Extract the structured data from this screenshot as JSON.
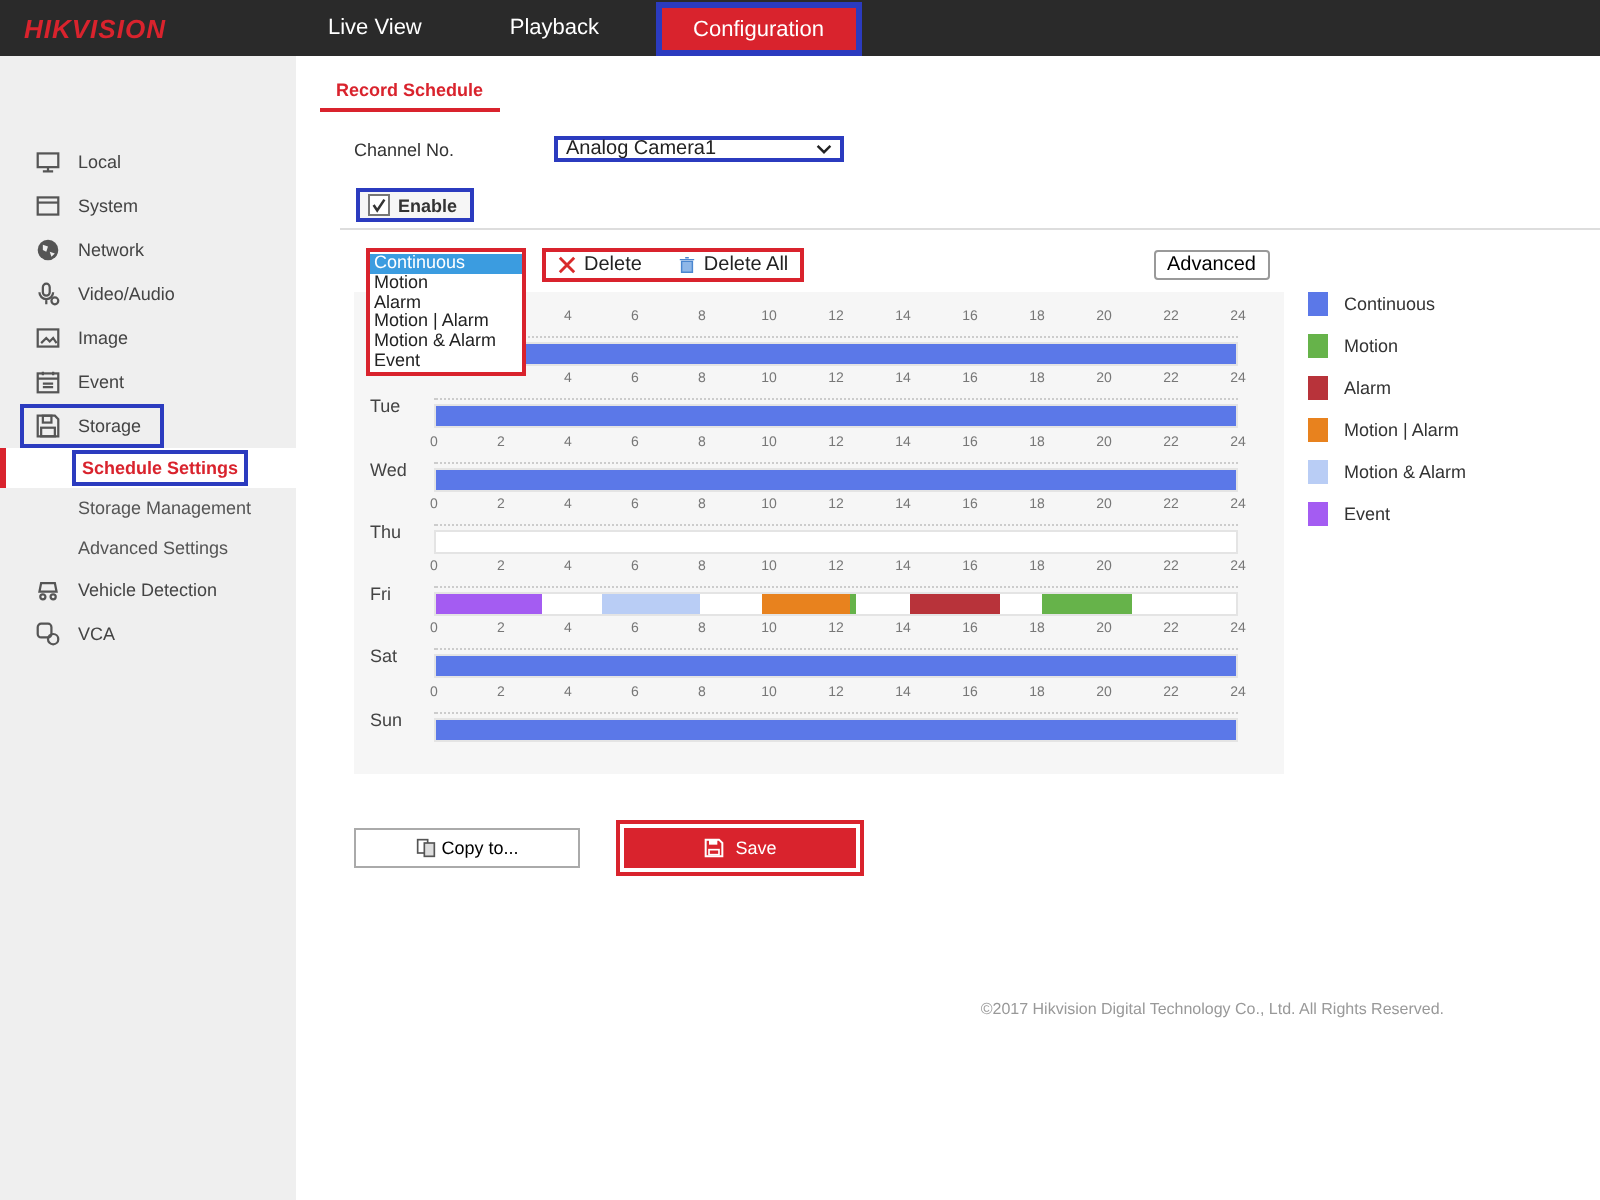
{
  "header": {
    "logo": "HIKVISION",
    "nav": [
      {
        "label": "Live View",
        "selected": false
      },
      {
        "label": "Playback",
        "selected": false
      },
      {
        "label": "Configuration",
        "selected": true,
        "color": "#2b3bbf"
      }
    ]
  },
  "sidebar": {
    "items": [
      {
        "label": "Local",
        "selected": false
      },
      {
        "label": "System",
        "selected": false
      },
      {
        "label": "Network",
        "selected": false
      },
      {
        "label": "Video/Audio",
        "selected": false
      },
      {
        "label": "Image",
        "selected": false
      },
      {
        "label": "Event",
        "selected": false
      },
      {
        "label": "Storage",
        "selected": false,
        "color": "#2b3bbf",
        "children": [
          {
            "label": "Schedule Settings",
            "selected": true,
            "color": "#2b3bbf"
          },
          {
            "label": "Storage Management",
            "selected": false
          },
          {
            "label": "Advanced Settings",
            "selected": false
          }
        ]
      },
      {
        "label": "Vehicle Detection",
        "selected": false
      },
      {
        "label": "VCA",
        "selected": false
      }
    ]
  },
  "tabs": [
    {
      "label": "Record Schedule",
      "selected": true
    }
  ],
  "channel": {
    "label": "Channel No.",
    "value": "Analog Camera1",
    "color": "#2b3bbf"
  },
  "enable": {
    "label": "Enable",
    "checked": true,
    "color": "#2b3bbf"
  },
  "record_type_list": {
    "color": "#d9232d",
    "options": [
      {
        "label": "Continuous",
        "selected": true
      },
      {
        "label": "Motion",
        "selected": false
      },
      {
        "label": "Alarm",
        "selected": false
      },
      {
        "label": "Motion | Alarm",
        "selected": false
      },
      {
        "label": "Motion & Alarm",
        "selected": false
      },
      {
        "label": "Event",
        "selected": false
      }
    ]
  },
  "toolbar": {
    "color": "#d9232d",
    "buttons": [
      {
        "kind": "delete",
        "label": "Delete"
      },
      {
        "kind": "delete_all",
        "label": "Delete All"
      }
    ],
    "advanced": "Advanced"
  },
  "schedule": {
    "days": [
      {
        "ticks": [
          "4",
          "6",
          "8",
          "10",
          "12",
          "14",
          "16",
          "18",
          "20",
          "22",
          "24"
        ],
        "segments": [
          {
            "kind": "continuous"
          }
        ]
      },
      {
        "day": "Tue",
        "ticks": [
          "4",
          "6",
          "8",
          "10",
          "12",
          "14",
          "16",
          "18",
          "20",
          "22",
          "24"
        ],
        "segments": [
          {
            "kind": "continuous"
          }
        ]
      },
      {
        "day": "Wed",
        "ticks": [
          "0",
          "2",
          "4",
          "6",
          "8",
          "10",
          "12",
          "14",
          "16",
          "18",
          "20",
          "22",
          "24"
        ],
        "segments": [
          {
            "kind": "continuous"
          }
        ]
      },
      {
        "day": "Thu",
        "ticks": [
          "0",
          "2",
          "4",
          "6",
          "8",
          "10",
          "12",
          "14",
          "16",
          "18",
          "20",
          "22",
          "24"
        ]
      },
      {
        "day": "Fri",
        "ticks": [
          "0",
          "2",
          "4",
          "6",
          "8",
          "10",
          "12",
          "14",
          "16",
          "18",
          "20",
          "22",
          "24"
        ],
        "segments": [
          {
            "kind": "event"
          },
          {
            "kind": "motion_and_alarm"
          },
          {
            "kind": "motion_or_alarm"
          },
          {
            "kind": "motion"
          },
          {
            "kind": "alarm"
          },
          {
            "kind": "motion"
          }
        ]
      },
      {
        "day": "Sat",
        "ticks": [
          "0",
          "2",
          "4",
          "6",
          "8",
          "10",
          "12",
          "14",
          "16",
          "18",
          "20",
          "22",
          "24"
        ],
        "segments": [
          {
            "kind": "continuous"
          }
        ]
      },
      {
        "day": "Sun",
        "ticks": [
          "0",
          "2",
          "4",
          "6",
          "8",
          "10",
          "12",
          "14",
          "16",
          "18",
          "20",
          "22",
          "24"
        ],
        "segments": [
          {
            "kind": "continuous"
          }
        ]
      }
    ]
  },
  "legend": [
    {
      "kind": "continuous",
      "label": "Continuous",
      "color": "#5b78e8"
    },
    {
      "kind": "motion",
      "label": "Motion",
      "color": "#66b34a"
    },
    {
      "kind": "alarm",
      "label": "Alarm",
      "color": "#b8333a"
    },
    {
      "kind": "motion_or_alarm",
      "label": "Motion | Alarm",
      "color": "#e8821e"
    },
    {
      "kind": "motion_and_alarm",
      "label": "Motion & Alarm",
      "color": "#b9cdf5"
    },
    {
      "kind": "event",
      "label": "Event",
      "color": "#a45cf2"
    }
  ],
  "buttons": [
    {
      "kind": "copy",
      "label": "Copy to..."
    },
    {
      "kind": "save",
      "label": "Save",
      "color": "#d9232d"
    }
  ],
  "footer": {
    "copyright": "©2017 Hikvision Digital Technology Co., Ltd. All Rights Reserved."
  }
}
